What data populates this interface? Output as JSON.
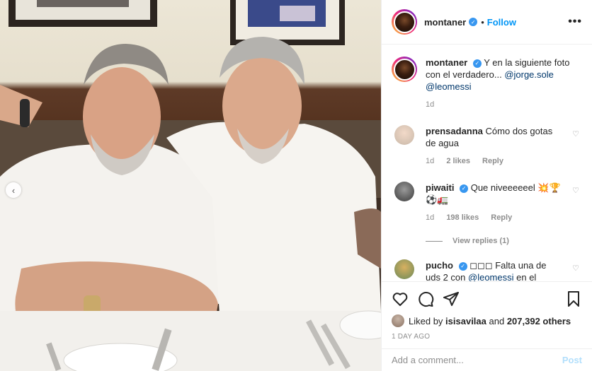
{
  "post": {
    "username": "montaner",
    "follow_label": "Follow",
    "more_label": "•••",
    "carousel_prev": "‹"
  },
  "caption": {
    "username": "montaner",
    "text": "Y en la siguiente foto con el verdadero...",
    "mention1": "@jorge.sole",
    "mention2": "@leomessi",
    "time": "1d"
  },
  "comments": [
    {
      "username": "prensadanna",
      "text": "Cómo dos gotas de agua",
      "time": "1d",
      "likes": "2 likes",
      "reply": "Reply",
      "avatar_color": "#e9e4df"
    },
    {
      "username": "piwaiti",
      "verified": true,
      "text": "Que niveeeeeel 💥🏆 ⚽🚛",
      "time": "1d",
      "likes": "198 likes",
      "reply": "Reply",
      "avatar_color": "#6b6b6b"
    },
    {
      "username": "pucho",
      "verified": true,
      "text_before": "◻◻◻ Falta una de uds 2 con",
      "mention": "@leomessi",
      "text_after": "en el medio",
      "avatar_color": "#7a9a6a"
    }
  ],
  "view_replies": "View replies (1)",
  "likes": {
    "prefix": "Liked by",
    "user": "isisavilaa",
    "middle": "and",
    "count": "207,392 others"
  },
  "ago": "1 DAY AGO",
  "add_comment": {
    "placeholder": "Add a comment...",
    "post_label": "Post"
  },
  "icons": {
    "heart": "heart-icon",
    "comment": "comment-icon",
    "share": "share-icon",
    "save": "bookmark-icon",
    "small_heart": "♡"
  },
  "colors": {
    "link": "#00376b",
    "follow": "#0095f6",
    "verified": "#3897f0",
    "muted": "#8e8e8e"
  }
}
